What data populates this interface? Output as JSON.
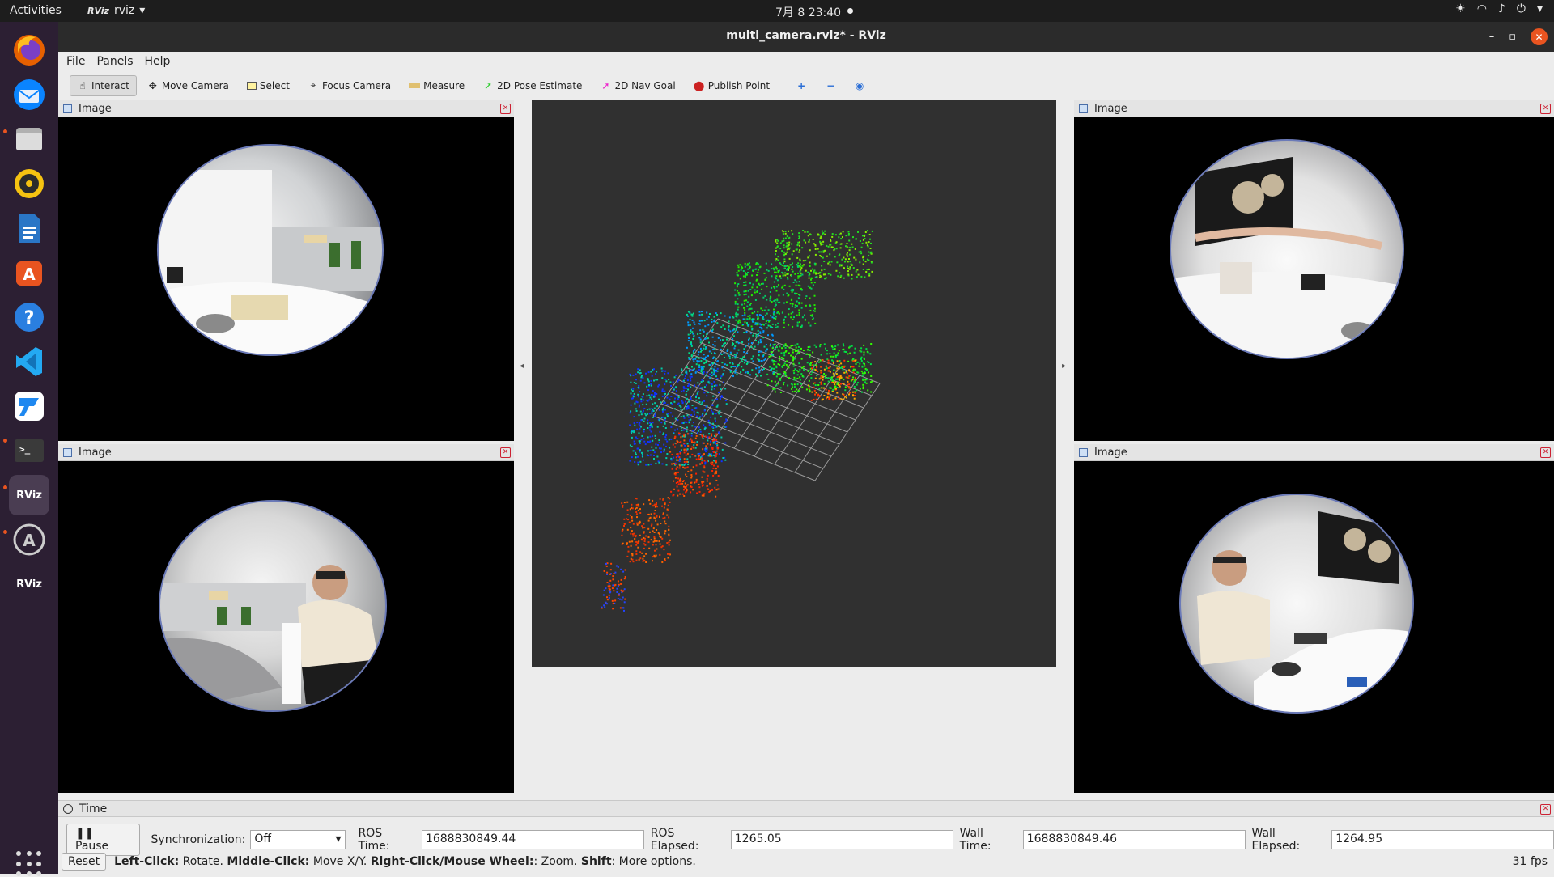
{
  "topbar": {
    "activities": "Activities",
    "app_name": "rviz",
    "app_logo": "RViz",
    "clock": "7月 8  23:40",
    "tray_icons": [
      "brightness-icon",
      "wifi-icon",
      "volume-icon",
      "power-icon"
    ]
  },
  "dock": {
    "items": [
      "firefox-icon",
      "thunderbird-icon",
      "files-icon",
      "rhythmbox-icon",
      "libreoffice-writer-icon",
      "app-center-icon",
      "help-icon",
      "vscode-icon",
      "todesk-icon",
      "terminal-icon",
      "rviz-icon",
      "software-updater-icon",
      "rviz-icon"
    ],
    "rviz_label": "RViz"
  },
  "window": {
    "title": "multi_camera.rviz* - RViz"
  },
  "menu": {
    "file": "File",
    "panels": "Panels",
    "help": "Help"
  },
  "toolbar": {
    "interact": "Interact",
    "move_camera": "Move Camera",
    "select": "Select",
    "focus_camera": "Focus Camera",
    "measure": "Measure",
    "pose_estimate": "2D Pose Estimate",
    "nav_goal": "2D Nav Goal",
    "publish_point": "Publish Point"
  },
  "panels": {
    "top_left": "Image",
    "bottom_left": "Image",
    "top_right": "Image",
    "bottom_right": "Image"
  },
  "time": {
    "title": "Time",
    "pause": "Pause",
    "sync_label": "Synchronization:",
    "sync_value": "Off",
    "ros_time_label": "ROS Time:",
    "ros_time": "1688830849.44",
    "ros_elapsed_label": "ROS Elapsed:",
    "ros_elapsed": "1265.05",
    "wall_time_label": "Wall Time:",
    "wall_time": "1688830849.46",
    "wall_elapsed_label": "Wall Elapsed:",
    "wall_elapsed": "1264.95"
  },
  "status": {
    "reset": "Reset",
    "left_click": "Left-Click:",
    "left_click_text": "Rotate.",
    "middle_click": "Middle-Click:",
    "middle_click_text": "Move X/Y.",
    "right_click": "Right-Click/Mouse Wheel:",
    "right_click_text": ": Zoom.",
    "shift": "Shift",
    "shift_text": ": More options.",
    "fps": "31 fps"
  },
  "colors": {
    "accent": "#e95420",
    "dock_bg": "#2c1f33",
    "view_bg": "#303030"
  }
}
